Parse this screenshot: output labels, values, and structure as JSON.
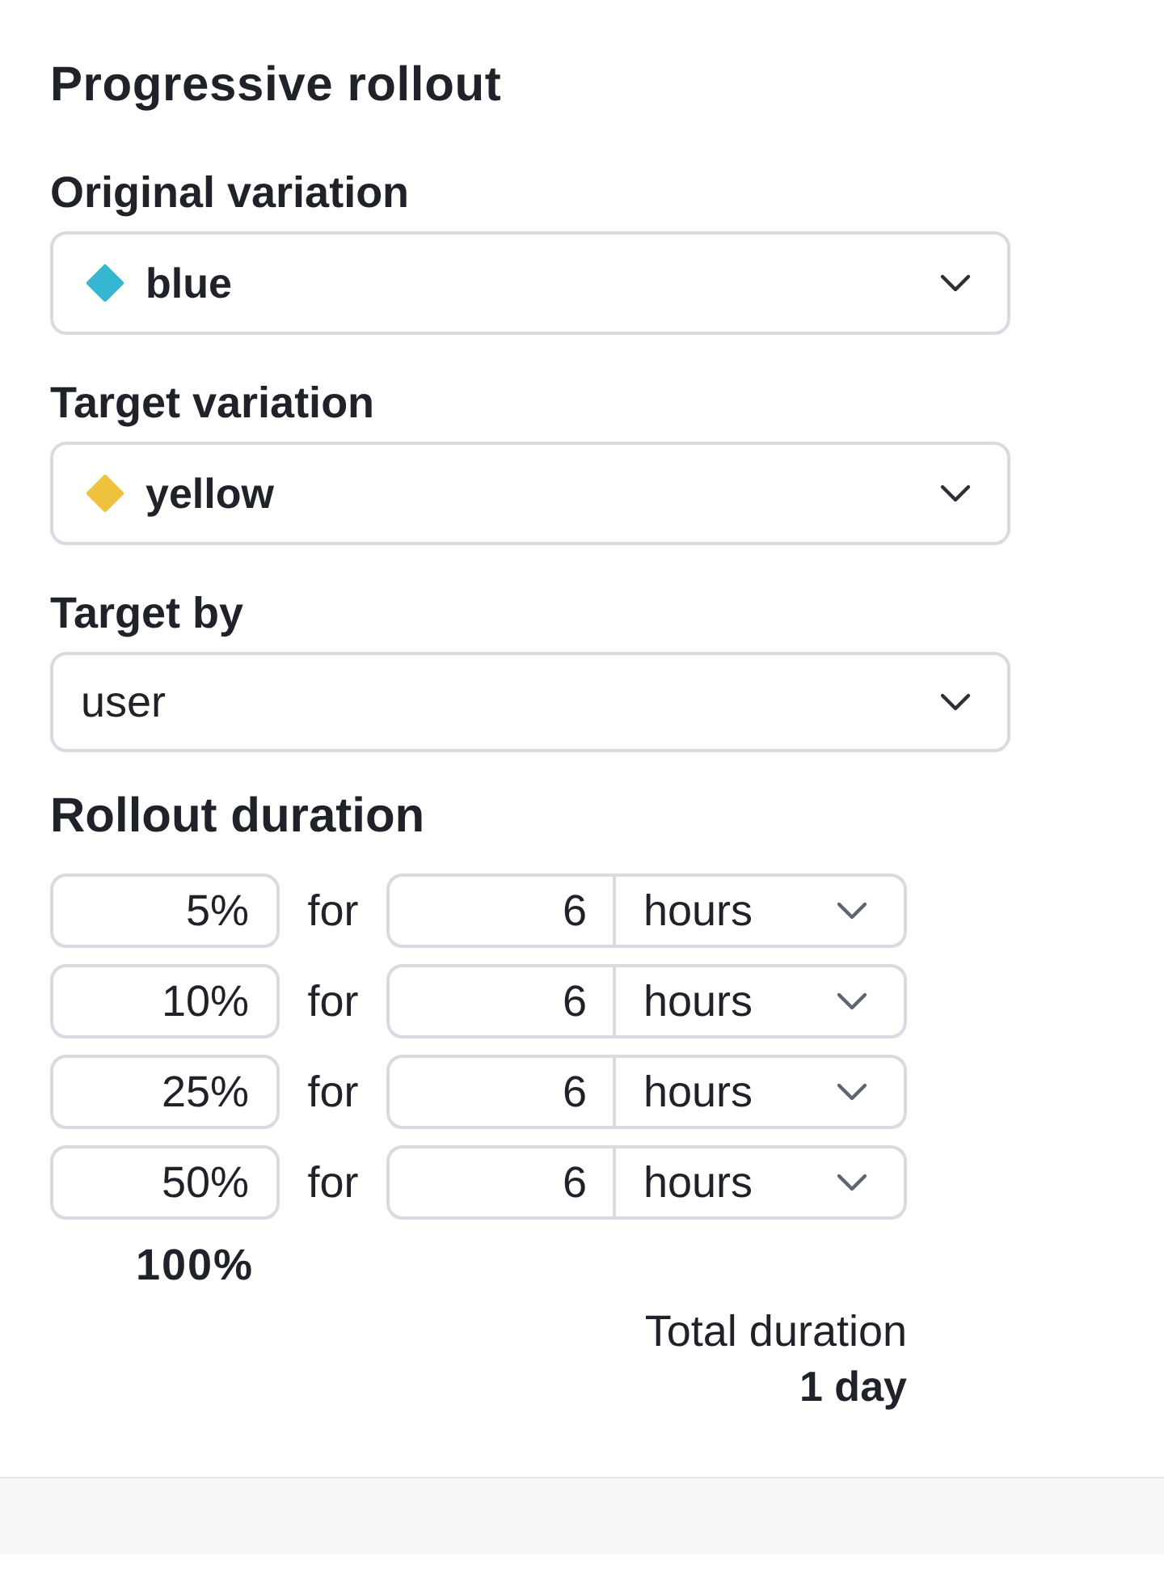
{
  "title": "Progressive rollout",
  "fields": [
    {
      "kind": "variation",
      "label": "Original variation",
      "value": "blue",
      "color": "#36b6d1"
    },
    {
      "kind": "variation",
      "label": "Target variation",
      "value": "yellow",
      "color": "#efc23e"
    },
    {
      "kind": "plain",
      "label": "Target by",
      "value": "user"
    }
  ],
  "rollout_duration": {
    "heading": "Rollout duration",
    "steps": [
      {
        "percent": "5%",
        "connector": "for",
        "amount": "6",
        "unit": "hours"
      },
      {
        "percent": "10%",
        "connector": "for",
        "amount": "6",
        "unit": "hours"
      },
      {
        "percent": "25%",
        "connector": "for",
        "amount": "6",
        "unit": "hours"
      },
      {
        "percent": "50%",
        "connector": "for",
        "amount": "6",
        "unit": "hours"
      }
    ],
    "final_percent": "100%",
    "total_label": "Total duration",
    "total_value": "1 day"
  }
}
